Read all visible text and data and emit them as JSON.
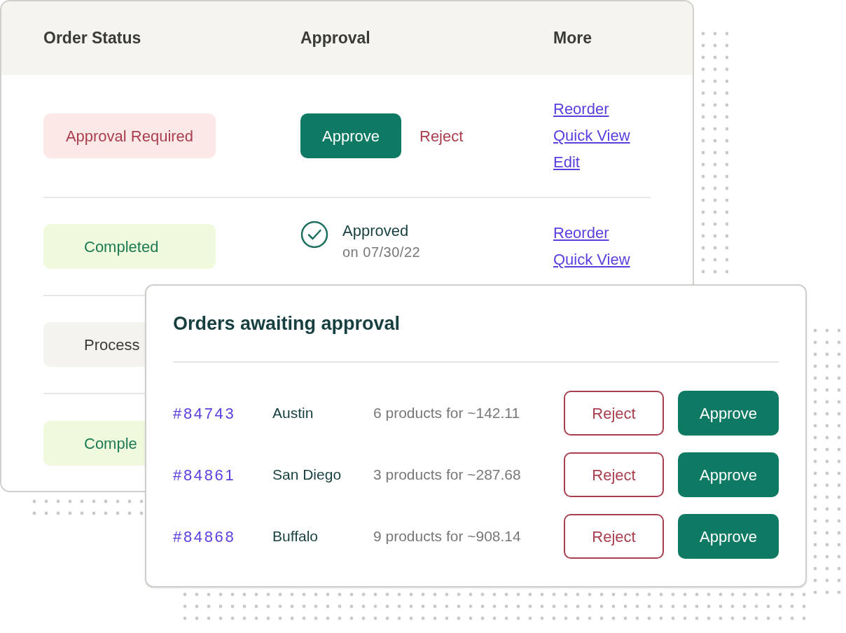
{
  "table": {
    "columns": [
      "Order Status",
      "Approval",
      "More"
    ],
    "rows": [
      {
        "status": {
          "text": "Approval Required",
          "kind": "required"
        },
        "approval": {
          "kind": "actions",
          "approve": "Approve",
          "reject": "Reject"
        },
        "links": [
          "Reorder",
          "Quick View",
          "Edit"
        ]
      },
      {
        "status": {
          "text": "Completed",
          "kind": "completed"
        },
        "approval": {
          "kind": "approved",
          "label": "Approved",
          "date": "on 07/30/22"
        },
        "links": [
          "Reorder",
          "Quick View"
        ]
      },
      {
        "status": {
          "text": "Process",
          "kind": "processing"
        }
      },
      {
        "status": {
          "text": "Comple",
          "kind": "completed"
        }
      }
    ]
  },
  "popup": {
    "title": "Orders awaiting approval",
    "orders": [
      {
        "number": "#84743",
        "city": "Austin",
        "summary": "6 products for ~142.11",
        "reject": "Reject",
        "approve": "Approve"
      },
      {
        "number": "#84861",
        "city": "San Diego",
        "summary": "3 products for ~287.68",
        "reject": "Reject",
        "approve": "Approve"
      },
      {
        "number": "#84868",
        "city": "Buffalo",
        "summary": "9 products for ~908.14",
        "reject": "Reject",
        "approve": "Approve"
      }
    ]
  }
}
